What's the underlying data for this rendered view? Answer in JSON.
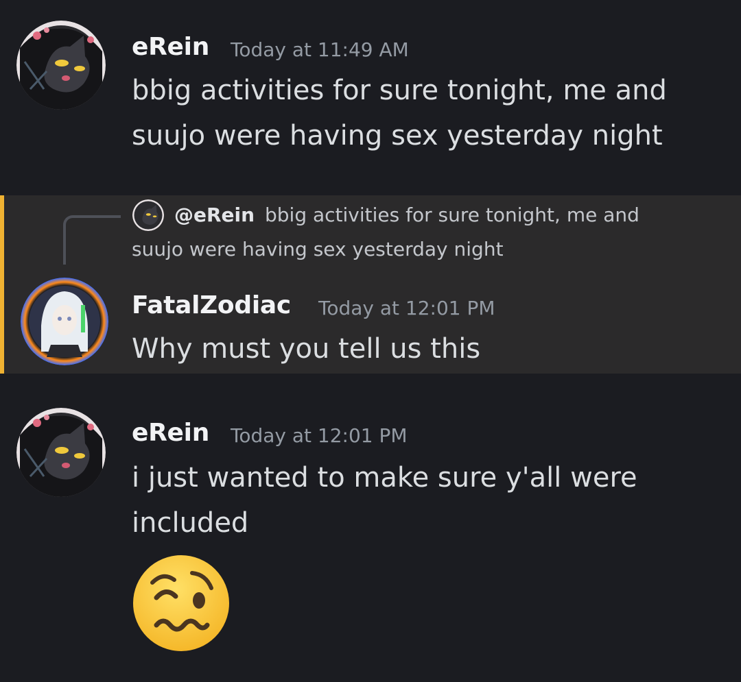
{
  "messages": [
    {
      "username": "eRein",
      "timestamp": "Today at 11:49 AM",
      "lines": [
        "bbig activities for sure tonight, me and",
        "suujo were having sex yesterday night"
      ],
      "avatar_icon": "black-cat-avatar-icon"
    },
    {
      "reply": {
        "mention": "@eRein",
        "text_line_1": "bbig activities for sure tonight, me and",
        "text_line_2": "suujo were having sex yesterday night"
      },
      "username": "FatalZodiac",
      "timestamp": "Today at 12:01 PM",
      "lines": [
        "Why must you tell us this"
      ],
      "avatar_icon": "anime-character-avatar-icon",
      "highlighted": true
    },
    {
      "username": "eRein",
      "timestamp": "Today at 12:01 PM",
      "lines": [
        "i just wanted to make sure y'all were",
        "included"
      ],
      "emoji": "woozy-face-emoji",
      "avatar_icon": "black-cat-avatar-icon"
    }
  ],
  "colors": {
    "background": "#1b1c21",
    "highlight_background": "#2b2a2b",
    "mention_bar": "#f0b232",
    "username": "#f2f3f5",
    "timestamp": "#949ba4",
    "message_text": "#dbdee1"
  }
}
